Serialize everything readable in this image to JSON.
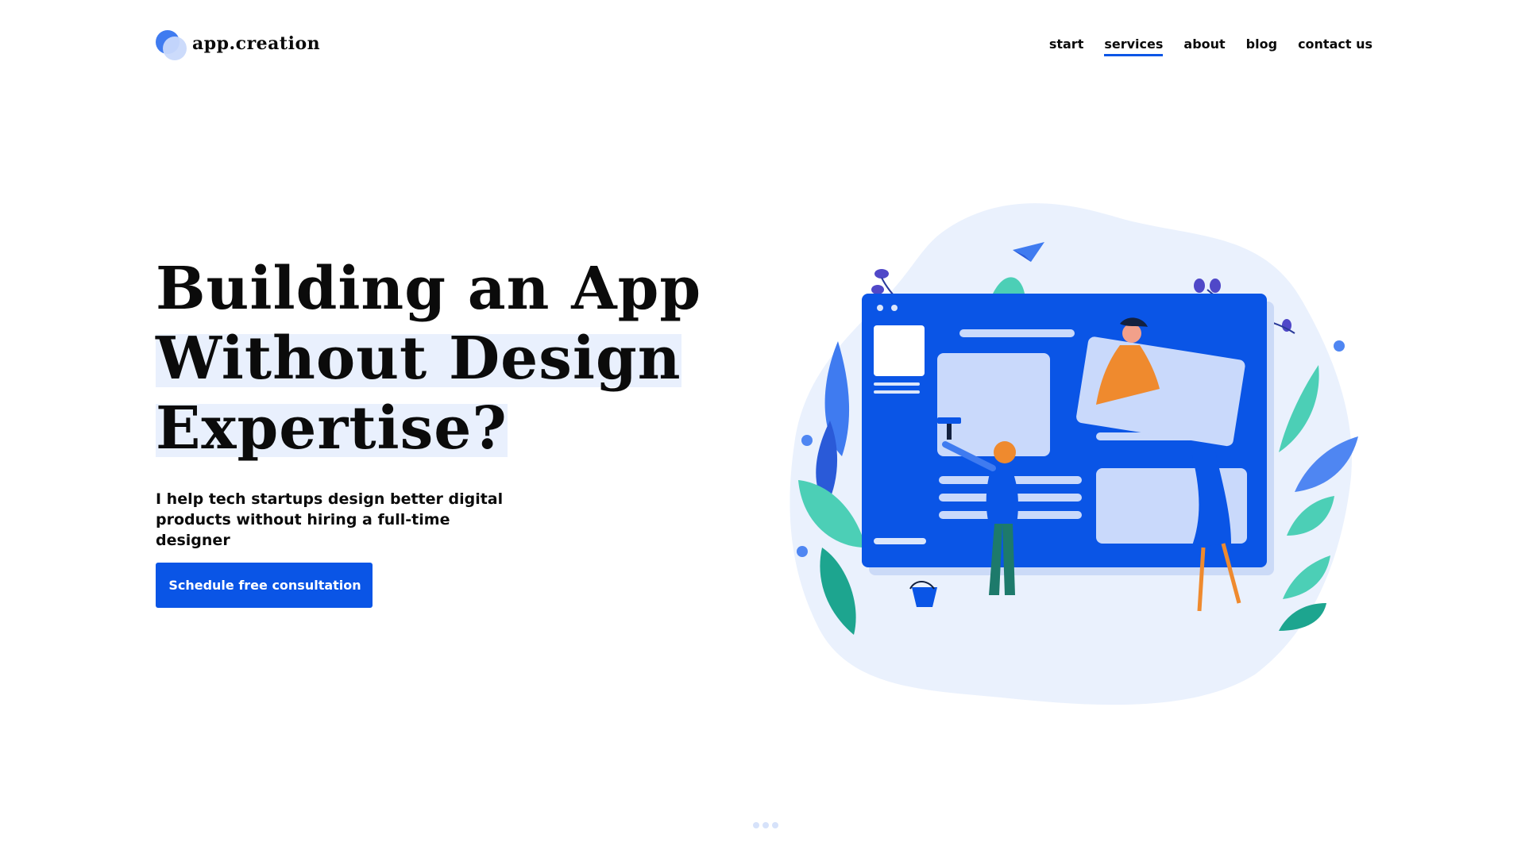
{
  "brand": {
    "name": "app.creation",
    "logo_icon": "overlapping-circles-logo"
  },
  "nav": {
    "items": [
      {
        "label": "start"
      },
      {
        "label": "services",
        "active": true
      },
      {
        "label": "about"
      },
      {
        "label": "blog"
      },
      {
        "label": "contact us"
      }
    ]
  },
  "hero": {
    "title_line1": "Building an App",
    "title_line2": "Without Design",
    "title_line3": "Expertise?",
    "subtitle_line1": "I help tech startups design better digital",
    "subtitle_line2": "products without hiring a full-time designer",
    "cta_label": "Schedule free consultation"
  },
  "illustration": {
    "icon": "designers-building-website-illustration"
  },
  "colors": {
    "accent": "#0a55e6",
    "highlight": "#e9f0fd",
    "blob": "#eaf1fd",
    "teal": "#4ccfb6",
    "orange": "#ef8a2e"
  }
}
